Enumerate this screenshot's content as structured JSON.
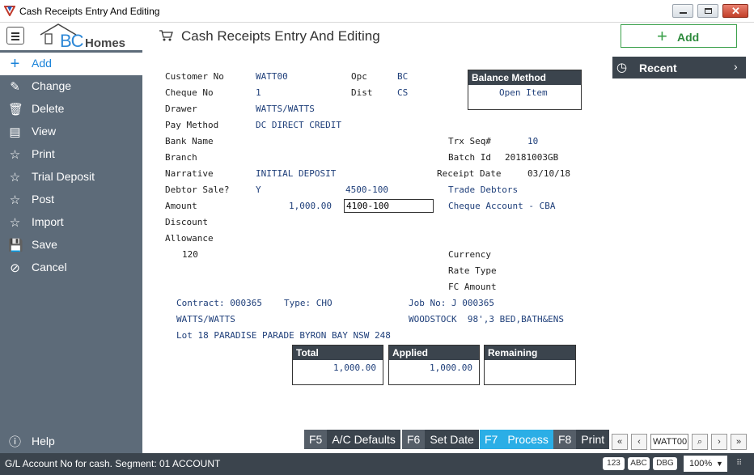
{
  "window": {
    "title": "Cash Receipts Entry And Editing"
  },
  "header": {
    "logo_text_bc": "BC",
    "logo_text_homes": "Homes",
    "page_title": "Cash Receipts Entry And Editing",
    "add_label": "Add"
  },
  "sidebar": {
    "items": [
      {
        "label": "Add",
        "icon": "plus-icon"
      },
      {
        "label": "Change",
        "icon": "edit-icon"
      },
      {
        "label": "Delete",
        "icon": "trash-icon"
      },
      {
        "label": "View",
        "icon": "table-icon"
      },
      {
        "label": "Print",
        "icon": "star-icon"
      },
      {
        "label": "Trial Deposit",
        "icon": "star-icon"
      },
      {
        "label": "Post",
        "icon": "star-icon"
      },
      {
        "label": "Import",
        "icon": "star-icon"
      },
      {
        "label": "Save",
        "icon": "save-icon"
      },
      {
        "label": "Cancel",
        "icon": "cancel-icon"
      }
    ],
    "help_label": "Help"
  },
  "recent": {
    "label": "Recent"
  },
  "form": {
    "customer_no_label": "Customer No",
    "customer_no": "WATT00",
    "opc_label": "Opc",
    "opc": "BC",
    "cheque_no_label": "Cheque No",
    "cheque_no": "1",
    "dist_label": "Dist",
    "dist": "CS",
    "drawer_label": "Drawer",
    "drawer": "WATTS/WATTS",
    "pay_method_label": "Pay Method",
    "pay_method": "DC DIRECT CREDIT",
    "bank_name_label": "Bank Name",
    "trx_seq_label": "Trx Seq#",
    "trx_seq": "10",
    "branch_label": "Branch",
    "batch_id_label": "Batch Id",
    "batch_id": "20181003GB",
    "narrative_label": "Narrative",
    "narrative": "INITIAL DEPOSIT",
    "receipt_date_label": "Receipt Date",
    "receipt_date": "03/10/18",
    "debtor_sale_label": "Debtor Sale?",
    "debtor_sale": "Y",
    "debtor_account": "4500-100",
    "debtor_account_name": "Trade Debtors",
    "amount_label": "Amount",
    "amount": "1,000.00",
    "gl_account": "4100-100",
    "gl_account_name": "Cheque Account - CBA",
    "discount_label": "Discount",
    "allowance_label": "Allowance",
    "allowance": "120",
    "currency_label": "Currency",
    "rate_type_label": "Rate Type",
    "fc_amount_label": "FC Amount"
  },
  "balance_method": {
    "title": "Balance Method",
    "value": "Open Item"
  },
  "contract": {
    "contract_label": "Contract: 000365",
    "type_label": "Type: CHO",
    "job_label": "Job No: J 000365",
    "name": "WATTS/WATTS",
    "description": "WOODSTOCK  98',3 BED,BATH&ENS",
    "address": "Lot 18 PARADISE PARADE BYRON BAY NSW 248"
  },
  "totals": {
    "total_title": "Total",
    "total_value": "1,000.00",
    "applied_title": "Applied",
    "applied_value": "1,000.00",
    "remaining_title": "Remaining",
    "remaining_value": ""
  },
  "fkeys": [
    {
      "key": "F5",
      "label": "A/C Defaults"
    },
    {
      "key": "F6",
      "label": "Set Date"
    },
    {
      "key": "F7",
      "label": "Process"
    },
    {
      "key": "F8",
      "label": "Print"
    }
  ],
  "nav": {
    "record_value": "WATT00"
  },
  "statusbar": {
    "message": "G/L Account No for cash.  Segment: 01 ACCOUNT",
    "pill1": "123",
    "pill2": "ABC",
    "pill3": "DBG",
    "zoom": "100%"
  },
  "colors": {
    "accent": "#1a83d9",
    "sidebar": "#5d6b79",
    "dark": "#3b444d",
    "green": "#2d8a3c",
    "process": "#2baee6"
  }
}
